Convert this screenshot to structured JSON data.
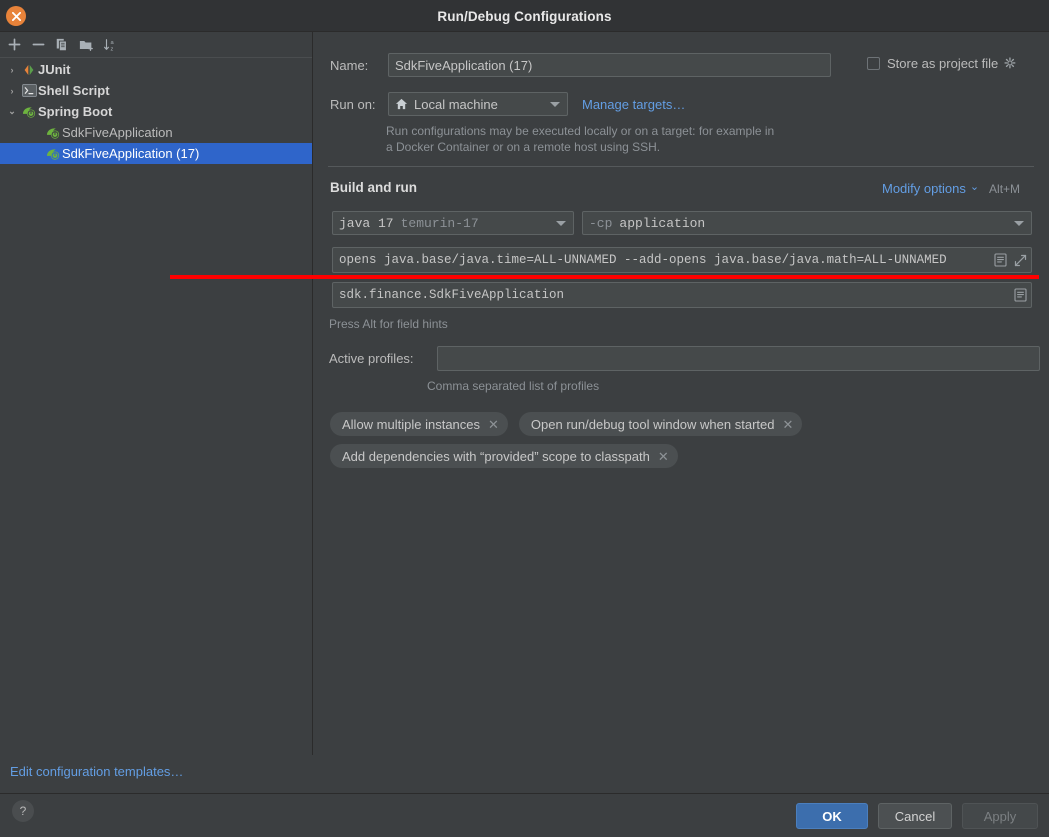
{
  "window": {
    "title": "Run/Debug Configurations",
    "close_icon": "close-icon"
  },
  "sidebar": {
    "toolbar": [
      {
        "name": "add-configuration-button",
        "icon": "plus-icon"
      },
      {
        "name": "remove-configuration-button",
        "icon": "minus-icon"
      },
      {
        "name": "copy-configuration-button",
        "icon": "copy-icon"
      },
      {
        "name": "move-into-folder-button",
        "icon": "new-folder-icon"
      },
      {
        "name": "sort-configurations-button",
        "icon": "sort-alpha-icon"
      }
    ],
    "tree": [
      {
        "label": "JUnit",
        "chevron": "›",
        "icon": "junit-icon",
        "level": 0,
        "group": true,
        "selected": false
      },
      {
        "label": "Shell Script",
        "chevron": "›",
        "icon": "shell-script-icon",
        "level": 0,
        "group": true,
        "selected": false
      },
      {
        "label": "Spring Boot",
        "chevron": "⌄",
        "icon": "spring-boot-icon",
        "level": 0,
        "group": true,
        "selected": false
      },
      {
        "label": "SdkFiveApplication",
        "chevron": "",
        "icon": "spring-boot-icon",
        "level": 1,
        "group": false,
        "selected": false
      },
      {
        "label": "SdkFiveApplication (17)",
        "chevron": "",
        "icon": "spring-boot-icon",
        "level": 1,
        "group": false,
        "selected": true
      }
    ],
    "edit_templates_link": "Edit configuration templates…"
  },
  "form": {
    "name_label": "Name:",
    "name_value": "SdkFiveApplication (17)",
    "store_as_project_file_label": "Store as project file",
    "store_as_project_file_checked": false,
    "store_gear_icon": "gear-icon",
    "run_on_label": "Run on:",
    "run_on_value": "Local machine",
    "run_on_icon": "home-icon",
    "manage_targets_link": "Manage targets…",
    "run_on_hint_line1": "Run configurations may be executed locally or on a target: for example in",
    "run_on_hint_line2": "a Docker Container or on a remote host using SSH.",
    "build_and_run_title": "Build and run",
    "modify_options_link": "Modify options",
    "modify_options_chevron": "⌄",
    "modify_options_shortcut": "Alt+M",
    "jdk_value_bold": "java 17",
    "jdk_value_dim": "temurin-17",
    "cp_value_dim": "-cp",
    "cp_value": "application",
    "vm_options_value": "opens java.base/java.time=ALL-UNNAMED --add-opens java.base/java.math=ALL-UNNAMED",
    "vm_options_macro_icon": "macro-icon",
    "vm_options_expand_icon": "expand-icon",
    "main_class_value": "sdk.finance.SdkFiveApplication",
    "main_class_macro_icon": "macro-icon",
    "field_hints_text": "Press Alt for field hints",
    "active_profiles_label": "Active profiles:",
    "active_profiles_value": "",
    "active_profiles_hint": "Comma separated list of profiles",
    "chips": [
      {
        "label": "Allow multiple instances",
        "close_icon": "chip-close-icon"
      },
      {
        "label": "Open run/debug tool window when started",
        "close_icon": "chip-close-icon"
      },
      {
        "label": "Add dependencies with “provided” scope to classpath",
        "close_icon": "chip-close-icon"
      }
    ]
  },
  "footer": {
    "help_label": "?",
    "ok_label": "OK",
    "cancel_label": "Cancel",
    "apply_label": "Apply"
  },
  "annotation": {
    "red_underline_color": "#ff0000"
  },
  "colors": {
    "accent_link": "#639ee4",
    "selection": "#2f65ca",
    "primary_button": "#3c6ead",
    "window_bg": "#3c3f41",
    "titlebar_bg": "#313335"
  }
}
